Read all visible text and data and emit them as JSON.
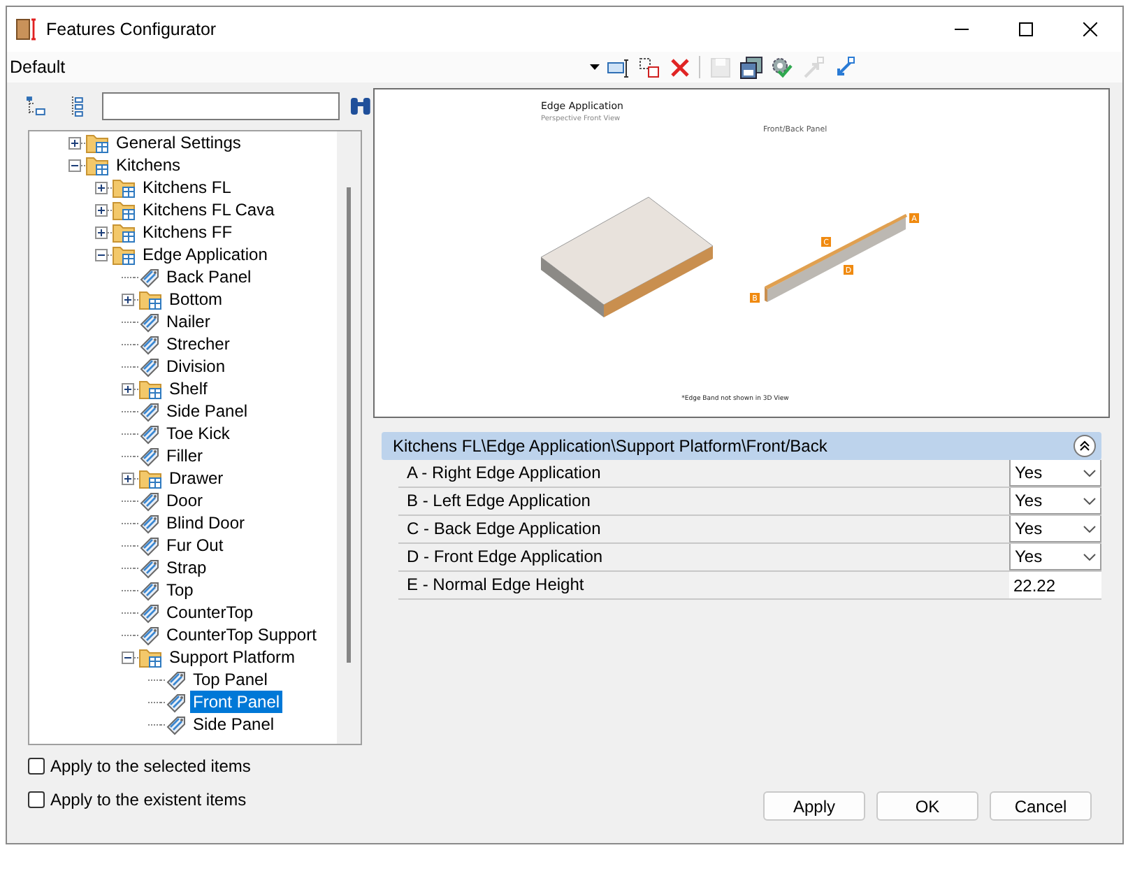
{
  "window": {
    "title": "Features Configurator"
  },
  "toolbar": {
    "profile": "Default",
    "tools": [
      {
        "kind": "rename",
        "disabled": false
      },
      {
        "kind": "copy",
        "disabled": false
      },
      {
        "kind": "delete",
        "disabled": false
      },
      {
        "kind": "separator"
      },
      {
        "kind": "save",
        "disabled": true
      },
      {
        "kind": "save_as",
        "disabled": false
      },
      {
        "kind": "apply_settings",
        "disabled": false
      },
      {
        "kind": "export",
        "disabled": true
      },
      {
        "kind": "import",
        "disabled": false
      }
    ]
  },
  "tree": {
    "items": [
      {
        "label": "General Settings",
        "kind": "folder",
        "expanded": false,
        "selected": false
      },
      {
        "label": "Kitchens",
        "kind": "folder",
        "expanded": true,
        "selected": false,
        "children": [
          {
            "label": "Kitchens FL",
            "kind": "folder",
            "expanded": false,
            "selected": false
          },
          {
            "label": "Kitchens FL Cava",
            "kind": "folder",
            "expanded": false,
            "selected": false
          },
          {
            "label": "Kitchens FF",
            "kind": "folder",
            "expanded": false,
            "selected": false
          },
          {
            "label": "Edge Application",
            "kind": "folder",
            "expanded": true,
            "selected": false,
            "children": [
              {
                "label": "Back Panel",
                "kind": "item",
                "selected": false
              },
              {
                "label": "Bottom",
                "kind": "folder",
                "expanded": false,
                "selected": false
              },
              {
                "label": "Nailer",
                "kind": "item",
                "selected": false
              },
              {
                "label": "Strecher",
                "kind": "item",
                "selected": false
              },
              {
                "label": "Division",
                "kind": "item",
                "selected": false
              },
              {
                "label": "Shelf",
                "kind": "folder",
                "expanded": false,
                "selected": false
              },
              {
                "label": "Side Panel",
                "kind": "item",
                "selected": false
              },
              {
                "label": "Toe Kick",
                "kind": "item",
                "selected": false
              },
              {
                "label": "Filler",
                "kind": "item",
                "selected": false
              },
              {
                "label": "Drawer",
                "kind": "folder",
                "expanded": false,
                "selected": false
              },
              {
                "label": "Door",
                "kind": "item",
                "selected": false
              },
              {
                "label": "Blind Door",
                "kind": "item",
                "selected": false
              },
              {
                "label": "Fur Out",
                "kind": "item",
                "selected": false
              },
              {
                "label": "Strap",
                "kind": "item",
                "selected": false
              },
              {
                "label": "Top",
                "kind": "item",
                "selected": false
              },
              {
                "label": "CounterTop",
                "kind": "item",
                "selected": false
              },
              {
                "label": "CounterTop Support",
                "kind": "item",
                "selected": false
              },
              {
                "label": "Support Platform",
                "kind": "folder",
                "expanded": true,
                "selected": false,
                "children": [
                  {
                    "label": "Top Panel",
                    "kind": "item",
                    "selected": false
                  },
                  {
                    "label": "Front Panel",
                    "kind": "item",
                    "selected": true
                  },
                  {
                    "label": "Side Panel",
                    "kind": "item",
                    "selected": false
                  }
                ]
              }
            ]
          }
        ]
      }
    ]
  },
  "preview": {
    "title": "Edge Application",
    "subtitle": "Perspective Front View",
    "panel_label": "Front/Back Panel",
    "markers": [
      "A",
      "C",
      "D",
      "B"
    ],
    "footnote": "*Edge Band not shown in 3D View"
  },
  "properties": {
    "category": "Kitchens FL\\Edge Application\\Support Platform\\Front/Back",
    "expanded": true,
    "rows": [
      {
        "label": "A - Right Edge Application",
        "kind": "select",
        "value": "Yes"
      },
      {
        "label": "B  - Left Edge Application",
        "kind": "select",
        "value": "Yes"
      },
      {
        "label": "C - Back Edge Application",
        "kind": "select",
        "value": "Yes"
      },
      {
        "label": "D - Front Edge Application",
        "kind": "select",
        "value": "Yes"
      },
      {
        "label": "E - Normal Edge Height",
        "kind": "text",
        "value": "22.22"
      }
    ]
  },
  "options": [
    {
      "label": "Apply to the selected items",
      "checked": false
    },
    {
      "label": "Apply to the existent items",
      "checked": false
    }
  ],
  "buttons": [
    "Apply",
    "OK",
    "Cancel"
  ]
}
